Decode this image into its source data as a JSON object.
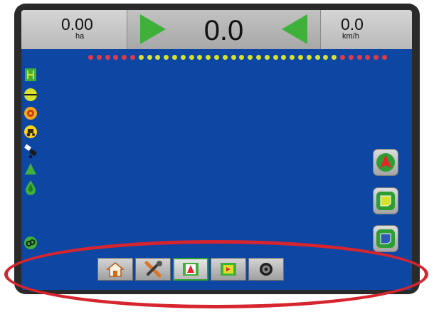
{
  "header": {
    "area_value": "0.00",
    "area_unit": "ha",
    "center_value": "0.0",
    "speed_value": "0.0",
    "speed_unit": "km/h"
  },
  "boom_sections": [
    "red",
    "red",
    "red",
    "red",
    "red",
    "red",
    "yellow",
    "yellow",
    "yellow",
    "yellow",
    "yellow",
    "yellow",
    "yellow",
    "yellow",
    "yellow",
    "yellow",
    "yellow",
    "yellow",
    "yellow",
    "yellow",
    "yellow",
    "yellow",
    "yellow",
    "yellow",
    "yellow",
    "yellow",
    "yellow",
    "yellow",
    "yellow",
    "yellow",
    "red",
    "red",
    "red",
    "red",
    "red",
    "red"
  ],
  "left_sidebar": [
    "field-boundary-icon",
    "guidance-line-icon",
    "target-icon",
    "tractor-icon",
    "satellite-icon",
    "tilt-icon",
    "drop-icon",
    "link-icon"
  ],
  "right_buttons": [
    "navigation-arrow-icon",
    "map-view-icon",
    "screen-view-icon"
  ],
  "bottom_tabs": [
    {
      "icon": "home-icon"
    },
    {
      "icon": "tools-icon"
    },
    {
      "icon": "vehicle-view-icon",
      "selected": true
    },
    {
      "icon": "field-view-icon"
    },
    {
      "icon": "camera-icon"
    }
  ],
  "colors": {
    "screen_bg": "#0d46a3",
    "guidance_green": "#3fb13a",
    "section_red": "#e23a4a",
    "section_yellow": "#d8e12a",
    "highlight": "#d7252f"
  }
}
